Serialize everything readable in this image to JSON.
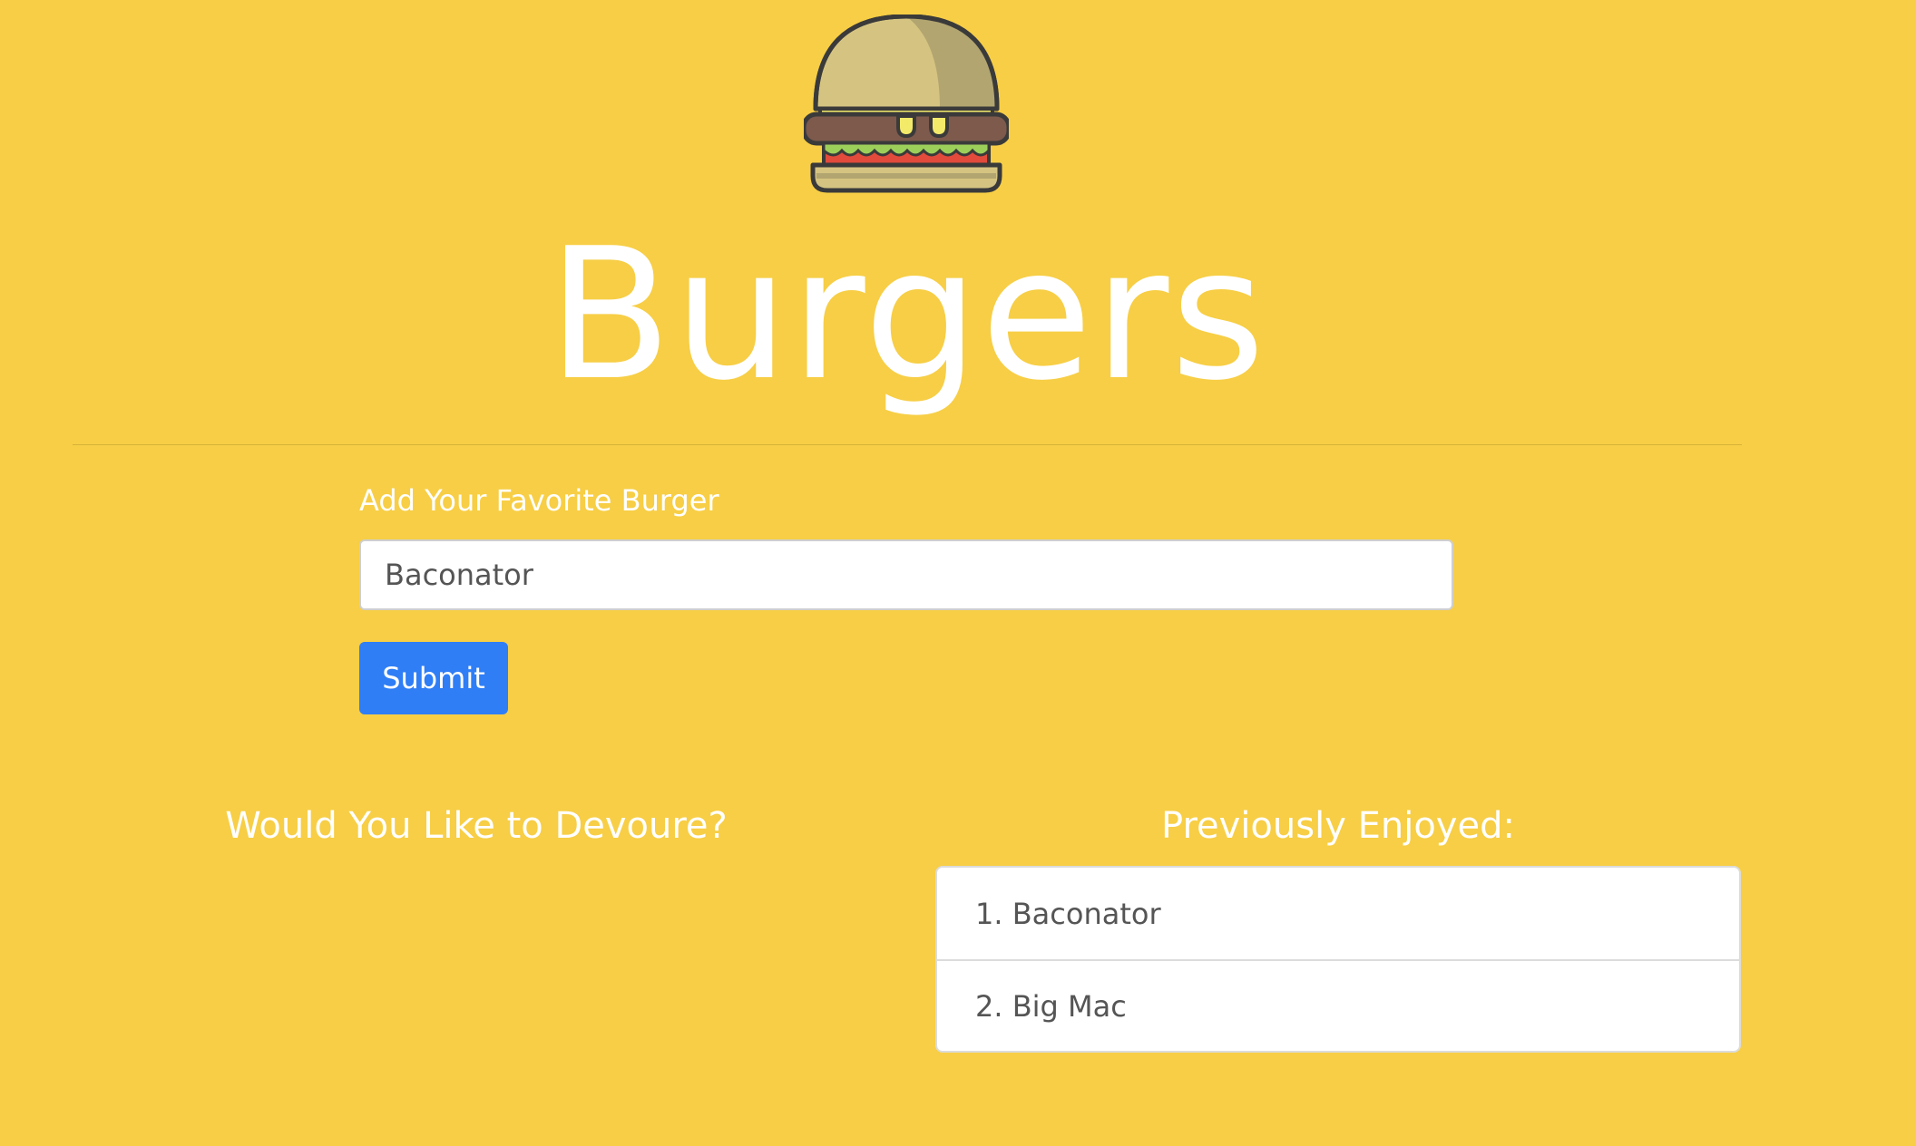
{
  "header": {
    "logo_icon": "burger-icon",
    "title": "Burgers"
  },
  "form": {
    "label": "Add Your Favorite Burger",
    "input_value": "Baconator",
    "submit_label": "Submit"
  },
  "devour": {
    "heading": "Would You Like to Devoure?",
    "items": []
  },
  "enjoyed": {
    "heading": "Previously Enjoyed:",
    "items": [
      {
        "label": "1. Baconator"
      },
      {
        "label": "2. Big Mac"
      }
    ]
  },
  "colors": {
    "background": "#f7ce45",
    "button": "#2f7ef6",
    "text_on_background": "#ffffff"
  }
}
